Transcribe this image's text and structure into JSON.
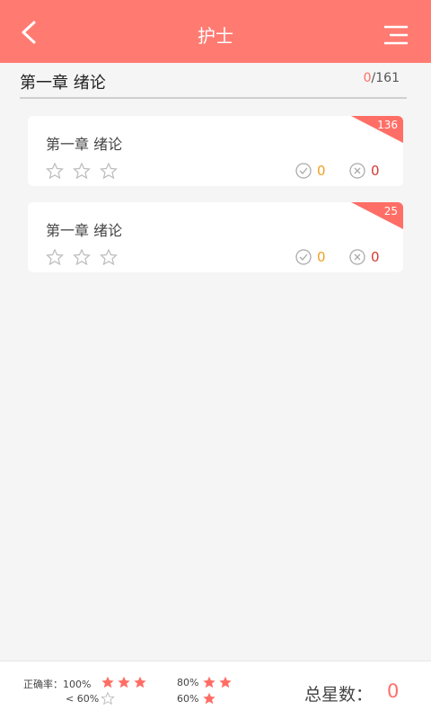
{
  "header": {
    "title": "护士"
  },
  "chapter": {
    "title": "第一章 绪论",
    "progress_done": "0",
    "progress_total": "/161"
  },
  "cards": [
    {
      "title": "第一章 绪论",
      "badge": "136",
      "right": "0",
      "wrong": "0"
    },
    {
      "title": "第一章 绪论",
      "badge": "25",
      "right": "0",
      "wrong": "0"
    }
  ],
  "footer": {
    "legend_label": "正确率：100%",
    "legend_80": "80%",
    "legend_lt60": "< 60%",
    "legend_60": "60%",
    "total_label": "总星数：",
    "total_value": "0"
  },
  "colors": {
    "accent": "#ff7b72",
    "star": "#ff6e66",
    "right": "#f0a020",
    "wrong": "#d43a2f"
  },
  "icons": [
    "back-icon",
    "menu-icon",
    "star-outline-icon",
    "check-circle-icon",
    "close-circle-icon",
    "star-filled-icon"
  ]
}
